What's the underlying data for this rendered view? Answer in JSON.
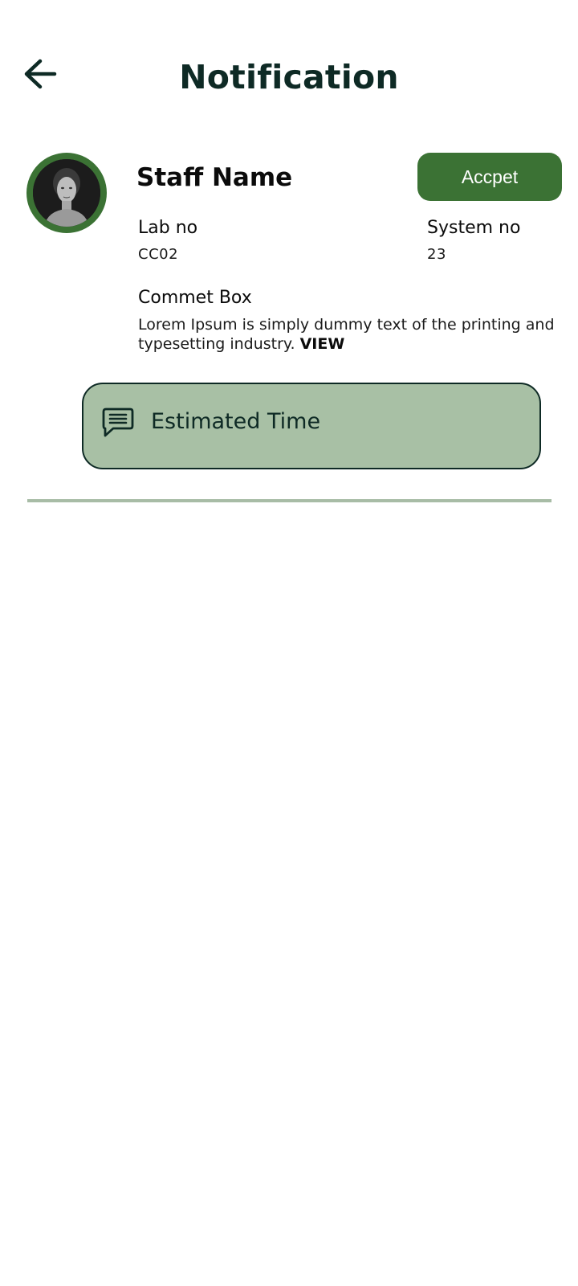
{
  "header": {
    "title": "Notification",
    "back_icon": "arrow-left-icon"
  },
  "notification": {
    "staff_name": "Staff Name",
    "accept_label": "Accpet",
    "lab_label": "Lab no",
    "lab_value": "CC02",
    "system_label": "System no",
    "system_value": "23",
    "comment_label": "Commet Box",
    "comment_text": "Lorem Ipsum is simply dummy text of the printing and typesetting industry. ",
    "view_label": "VIEW",
    "estimated_label": "Estimated Time",
    "estimated_icon": "chat-bubble-icon",
    "avatar_icon": "staff-avatar"
  },
  "colors": {
    "accent": "#3b7234",
    "title": "#0e2a25",
    "estimated_bg": "#a8c0a5",
    "divider": "#a8bca6"
  }
}
